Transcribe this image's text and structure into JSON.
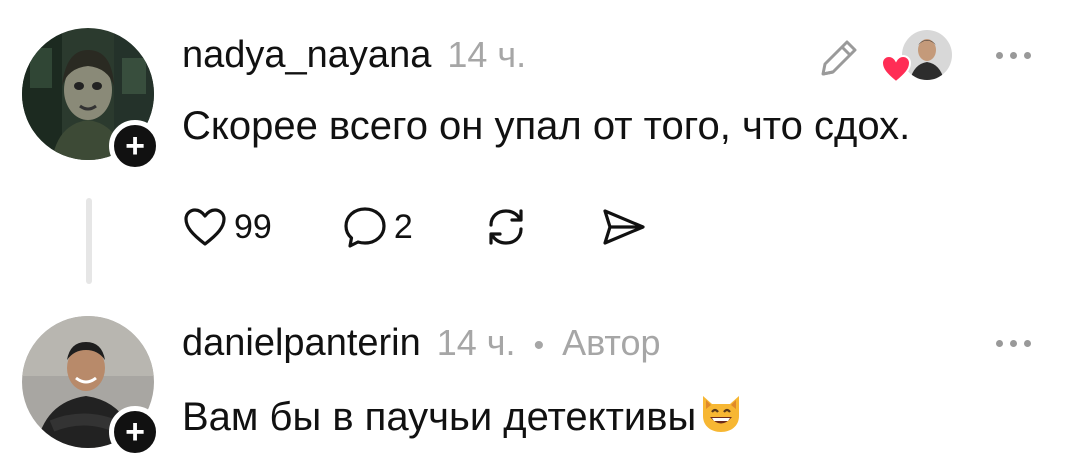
{
  "posts": [
    {
      "username": "nadya_nayana",
      "time": "14 ч.",
      "text": "Скорее всего он упал от того, что сдох.",
      "likes": "99",
      "replies": "2",
      "liked_by_author": true
    },
    {
      "username": "danielpanterin",
      "time": "14 ч.",
      "separator": "•",
      "author_label": "Автор",
      "text": "Вам бы в паучьи детективы",
      "emoji": "grinning-cat-emoji"
    }
  ],
  "icons": {
    "follow": "plus-icon",
    "like": "heart-outline-icon",
    "reply": "speech-bubble-icon",
    "repost": "repost-icon",
    "share": "send-icon",
    "edit": "pencil-icon",
    "more": "more-dots-icon"
  },
  "colors": {
    "heart_red": "#ff2d55",
    "muted": "#a6a6a6"
  }
}
